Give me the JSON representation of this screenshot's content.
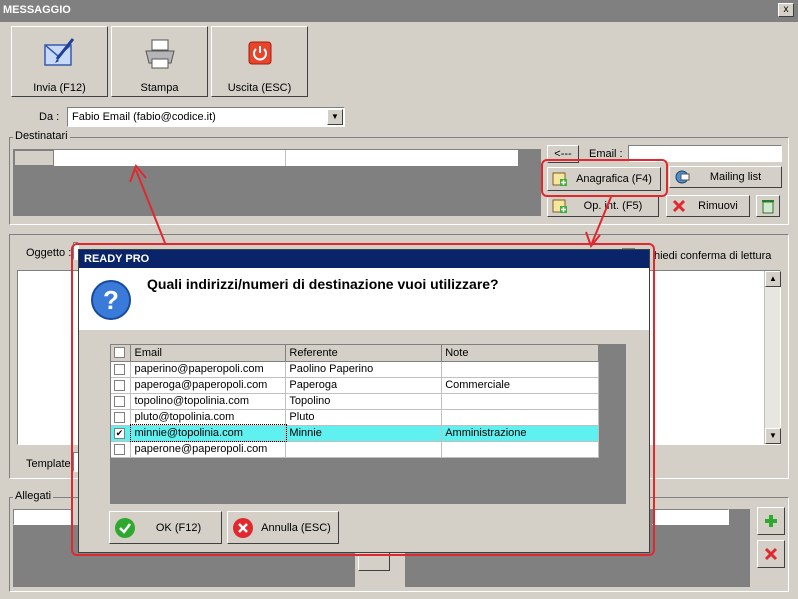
{
  "window": {
    "title": "MESSAGGIO",
    "close": "x"
  },
  "toolbar": {
    "send_label": "Invia (F12)",
    "print_label": "Stampa",
    "exit_label": "Uscita (ESC)"
  },
  "from": {
    "label": "Da :",
    "value": "Fabio Email (fabio@codice.it)"
  },
  "recipients": {
    "group_label": "Destinatari",
    "arrow_label": "<---",
    "email_label": "Email :",
    "email_value": "",
    "anagrafica_label": "Anagrafica (F4)",
    "mailing_label": "Mailing list",
    "opint_label": "Op. int. (F5)",
    "remove_label": "Rimuovi"
  },
  "subject": {
    "label": "Oggetto :",
    "read_receipt_label": "hiedi conferma di lettura"
  },
  "template_label": "Template",
  "attachments_label": "Allegati",
  "dialog": {
    "title": "READY PRO",
    "question": "Quali indirizzi/numeri di destinazione vuoi utilizzare?",
    "columns": [
      "Email",
      "Referente",
      "Note"
    ],
    "rows": [
      {
        "checked": false,
        "email": "paperino@paperopoli.com",
        "referente": "Paolino Paperino",
        "note": ""
      },
      {
        "checked": false,
        "email": "paperoga@paperopoli.com",
        "referente": "Paperoga",
        "note": "Commerciale"
      },
      {
        "checked": false,
        "email": "topolino@topolinia.com",
        "referente": "Topolino",
        "note": ""
      },
      {
        "checked": false,
        "email": "pluto@topolinia.com",
        "referente": "Pluto",
        "note": ""
      },
      {
        "checked": true,
        "email": "minnie@topolinia.com",
        "referente": "Minnie",
        "note": "Amministrazione"
      },
      {
        "checked": false,
        "email": "paperone@paperopoli.com",
        "referente": "",
        "note": ""
      }
    ],
    "ok_label": "OK (F12)",
    "cancel_label": "Annulla (ESC)"
  },
  "colors": {
    "highlight": "#e0282e",
    "selected_row": "#5ff0f0",
    "dialog_title": "#0a246a"
  }
}
